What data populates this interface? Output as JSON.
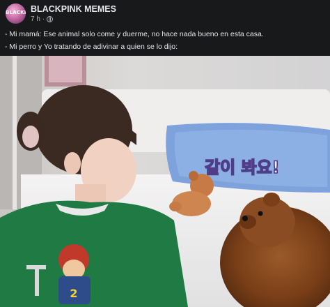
{
  "post": {
    "page_name": "BLACKPINK MEMES",
    "avatar_text": "BLACKPINK",
    "time": "7 h",
    "dot": "·",
    "caption_lines": [
      "- Mi mamá: Ese animal solo come y duerme, no hace nada bueno en esta casa.",
      "- Mi perro y Yo tratando de adivinar a quien se lo dijo:"
    ]
  },
  "photo": {
    "pillow_text": "같이 봐요!",
    "shirt_number": "2"
  },
  "colors": {
    "background": "#18191a",
    "text_primary": "#e4e6eb",
    "text_secondary": "#b0b3b8",
    "sweater": "#1f7a44",
    "pillow": "#7ea3dc"
  }
}
